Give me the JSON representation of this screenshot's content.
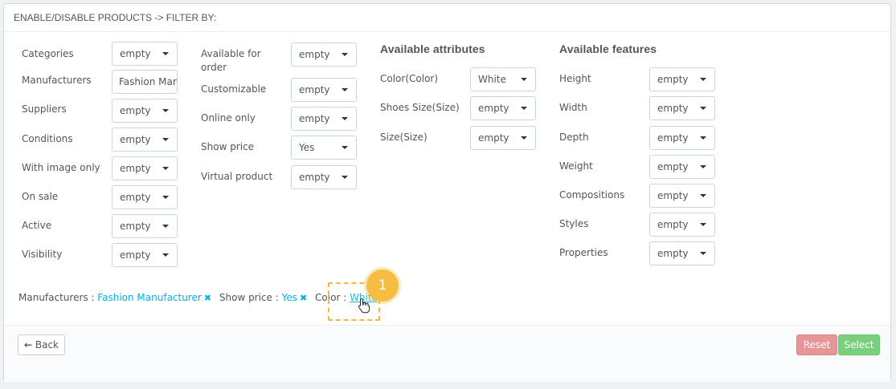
{
  "header": {
    "title": "ENABLE/DISABLE PRODUCTS -> FILTER BY:"
  },
  "col1": {
    "categories": {
      "label": "Categories",
      "value": "empty"
    },
    "manufacturers": {
      "label": "Manufacturers",
      "value": "Fashion Man"
    },
    "suppliers": {
      "label": "Suppliers",
      "value": "empty"
    },
    "conditions": {
      "label": "Conditions",
      "value": "empty"
    },
    "with_image": {
      "label": "With image only",
      "value": "empty"
    },
    "on_sale": {
      "label": "On sale",
      "value": "empty"
    },
    "active": {
      "label": "Active",
      "value": "empty"
    },
    "visibility": {
      "label": "Visibility",
      "value": "empty"
    }
  },
  "col2": {
    "available_for_order": {
      "label_line1": "Available for",
      "label_line2": "order",
      "value": "empty"
    },
    "customizable": {
      "label": "Customizable",
      "value": "empty"
    },
    "online_only": {
      "label": "Online only",
      "value": "empty"
    },
    "show_price": {
      "label": "Show price",
      "value": "Yes"
    },
    "virtual_product": {
      "label": "Virtual product",
      "value": "empty"
    }
  },
  "attributes": {
    "title": "Available attributes",
    "color": {
      "label": "Color(Color)",
      "value": "White"
    },
    "shoes_size": {
      "label": "Shoes Size(Size)",
      "value": "empty"
    },
    "size": {
      "label": "Size(Size)",
      "value": "empty"
    }
  },
  "features": {
    "title": "Available features",
    "height": {
      "label": "Height",
      "value": "empty"
    },
    "width": {
      "label": "Width",
      "value": "empty"
    },
    "depth": {
      "label": "Depth",
      "value": "empty"
    },
    "weight": {
      "label": "Weight",
      "value": "empty"
    },
    "compositions": {
      "label": "Compositions",
      "value": "empty"
    },
    "styles": {
      "label": "Styles",
      "value": "empty"
    },
    "properties": {
      "label": "Properties",
      "value": "empty"
    }
  },
  "active_filters": {
    "manufacturers_label": "Manufacturers :",
    "manufacturers_value": "Fashion Manufacturer",
    "show_price_label": "Show price :",
    "show_price_value": "Yes",
    "color_label": "Color :",
    "color_value": "White",
    "remove_icon": "✖"
  },
  "annotation": {
    "step": "1"
  },
  "footer": {
    "back_label": "Back",
    "back_icon": "arrow-left-icon",
    "reset_label": "Reset",
    "select_label": "Select"
  },
  "colors": {
    "accent": "#00aff0",
    "badge": "#f5bd41",
    "reset": "#e79597",
    "select": "#78d07d"
  }
}
